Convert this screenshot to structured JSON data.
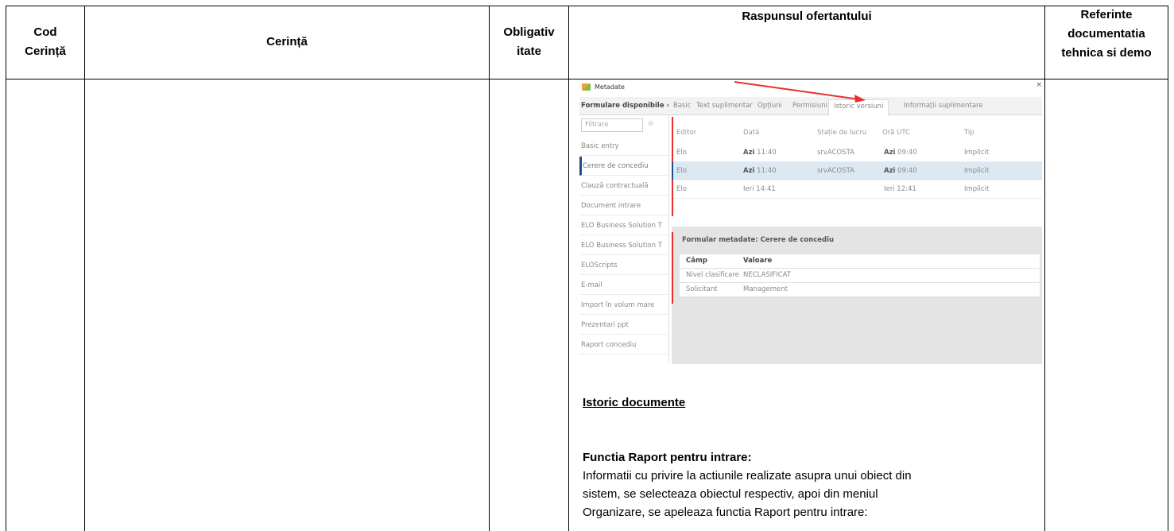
{
  "table": {
    "headers": {
      "cod_line1": "Cod",
      "cod_line2": "Cerință",
      "cerinta": "Cerință",
      "obligativ_line1": "Obligativ",
      "obligativ_line2": "itate",
      "raspuns": "Raspunsul ofertantului",
      "ref_line1": "Referinte",
      "ref_line2": "documentatia",
      "ref_line3": "tehnica si demo"
    }
  },
  "screenshot": {
    "window_title": "Metadate",
    "close_glyph": "×",
    "form_header": "Formulare disponibile ‹",
    "tabs": [
      "Basic",
      "Text suplimentar",
      "Opțiuni",
      "Permisiuni",
      "Istoric versiuni",
      "Informații suplimentare"
    ],
    "active_tab": "Istoric versiuni",
    "filter_placeholder": "Filtrare",
    "sidebar_items": [
      "Basic entry",
      "Cerere de concediu",
      "Clauză contractuală",
      "Document intrare",
      "ELO Business Solution T",
      "ELO Business Solution T",
      "ELOScripts",
      "E-mail",
      "Import în volum mare",
      "Prezentari ppt",
      "Raport concediu"
    ],
    "active_sidebar": "Cerere de concediu",
    "grid_columns": [
      "Editor",
      "Dată",
      "Stație de lucru",
      "Oră UTC",
      "Tip"
    ],
    "grid_rows": [
      {
        "editor": "Elo",
        "data_b": "Azi",
        "data": "11:40",
        "statie": "srvACOSTA",
        "ora_b": "Azi",
        "ora": "09:40",
        "tip": "Implicit"
      },
      {
        "editor": "Elo",
        "data_b": "Azi",
        "data": "11:40",
        "statie": "srvACOSTA",
        "ora_b": "Azi",
        "ora": "09:40",
        "tip": "Implicit"
      },
      {
        "editor": "Elo",
        "data_b": "",
        "data": "Ieri 14:41",
        "statie": "",
        "ora_b": "",
        "ora": "Ieri 12:41",
        "tip": "Implicit"
      }
    ],
    "meta_title": "Formular metadate: Cerere de concediu",
    "meta_columns": [
      "Câmp",
      "Valoare"
    ],
    "meta_rows": [
      {
        "camp": "Nivel clasificare",
        "valoare": "NECLASIFICAT"
      },
      {
        "camp": "Solicitant",
        "valoare": "Management"
      }
    ],
    "colors": {
      "arrow": "#e63030",
      "accent": "#1f4e8c",
      "selected_row": "#dce8f2"
    }
  },
  "text": {
    "istoric_heading": "Istoric documente",
    "functia_heading": "Functia Raport pentru intrare:",
    "line1": "Informatii cu privire la actiunile realizate asupra unui obiect din",
    "line2": "sistem, se selecteaza obiectul respectiv, apoi din meniul",
    "line3": "Organizare, se apeleaza functia Raport pentru intrare:"
  }
}
